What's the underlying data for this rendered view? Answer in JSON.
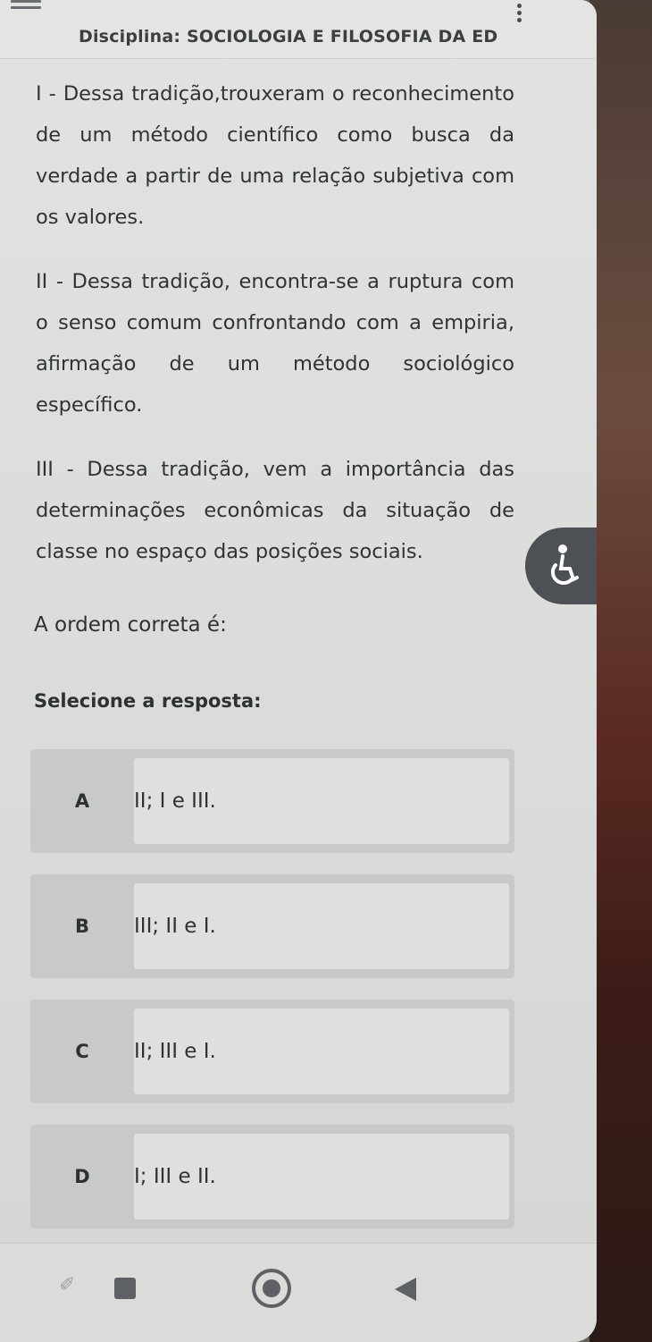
{
  "header": {
    "title": "Disciplina: SOCIOLOGIA E FILOSOFIA DA EDU(",
    "menu_icon": "hamburger-icon",
    "more_icon": "vertical-dots-icon"
  },
  "question": {
    "statements": [
      "I  -  Dessa  tradição,trouxeram  o reconhecimento de um método científico como busca da verdade a partir de uma relação subjetiva com os valores.",
      "II - Dessa tradição, encontra-se a ruptura com o senso comum confrontando com a empiria, afirmação de um método sociológico específico.",
      "III - Dessa tradição, vem a importância das determinações econômicas da situação de classe no espaço das posições sociais."
    ],
    "prompt": "A ordem correta é:"
  },
  "answer_section": {
    "label": "Selecione a resposta:",
    "options": [
      {
        "letter": "A",
        "text": "II; I e III."
      },
      {
        "letter": "B",
        "text": "III; II e I."
      },
      {
        "letter": "C",
        "text": "II; III e I."
      },
      {
        "letter": "D",
        "text": "I; III e II."
      }
    ]
  },
  "accessibility_button": {
    "icon": "accessibility-icon"
  },
  "nav": {
    "recents_icon": "square-icon",
    "home_icon": "circle-home-icon",
    "back_icon": "triangle-back-icon"
  }
}
